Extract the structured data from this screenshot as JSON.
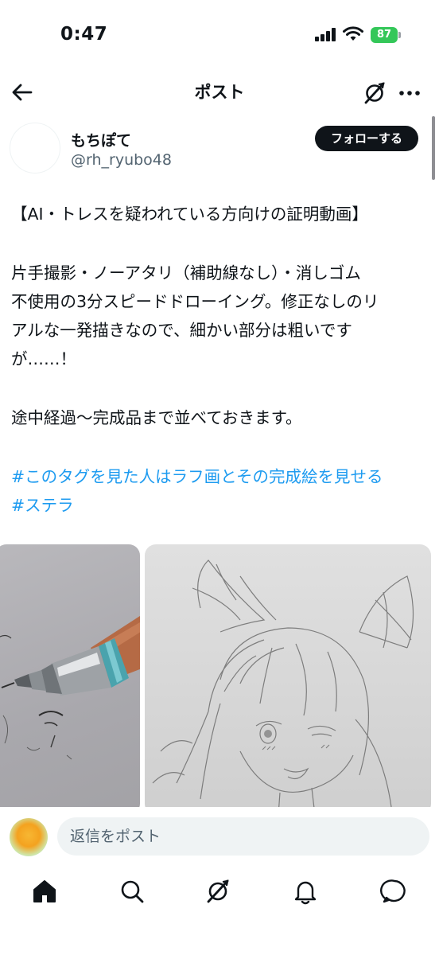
{
  "status": {
    "time": "0:47",
    "battery": "87"
  },
  "header": {
    "title": "ポスト"
  },
  "author": {
    "name": "もちぽて",
    "handle": "@rh_ryubo48",
    "follow_label": "フォローする"
  },
  "post": {
    "line1": "【AI・トレスを疑われている方向けの証明動画】",
    "line2": "片手撮影・ノーアタリ（補助線なし）・消しゴム",
    "line3": "不使用の3分スピードドローイング。修正なしのリ",
    "line4": "アルな一発描きなので、細かい部分は粗いです",
    "line5": "が……！",
    "line6": "途中経過〜完成品まで並べておきます。",
    "hashtag1": "#このタグを見た人はラフ画とその完成絵を見せる",
    "hashtag2": "#ステラ"
  },
  "reply": {
    "placeholder": "返信をポスト"
  },
  "colors": {
    "accent": "#1d9bf0",
    "text": "#0f1419",
    "muted": "#536471",
    "battery": "#34c759"
  },
  "icons": [
    "back-arrow-icon",
    "grok-icon",
    "more-icon",
    "home-icon",
    "search-icon",
    "grok-nav-icon",
    "notifications-icon",
    "messages-icon"
  ]
}
